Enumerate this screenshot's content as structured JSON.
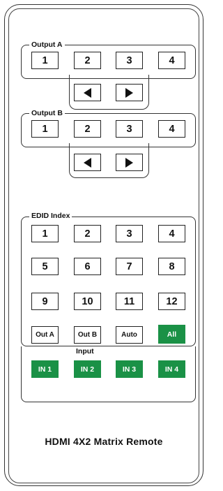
{
  "output_a": {
    "label": "Output A",
    "keys": [
      "1",
      "2",
      "3",
      "4"
    ]
  },
  "output_b": {
    "label": "Output B",
    "keys": [
      "1",
      "2",
      "3",
      "4"
    ]
  },
  "edid": {
    "label": "EDID Index",
    "keys": [
      "1",
      "2",
      "3",
      "4",
      "5",
      "6",
      "7",
      "8",
      "9",
      "10",
      "11",
      "12"
    ],
    "out_a": "Out A",
    "out_b": "Out B",
    "auto": "Auto",
    "all": "All"
  },
  "input": {
    "label": "Input",
    "keys": [
      "IN 1",
      "IN 2",
      "IN 3",
      "IN 4"
    ]
  },
  "title": "HDMI 4X2 Matrix Remote",
  "colors": {
    "green": "#1a9146",
    "ink": "#111111"
  },
  "icons": {
    "left": "left-arrow-icon",
    "right": "right-arrow-icon"
  }
}
